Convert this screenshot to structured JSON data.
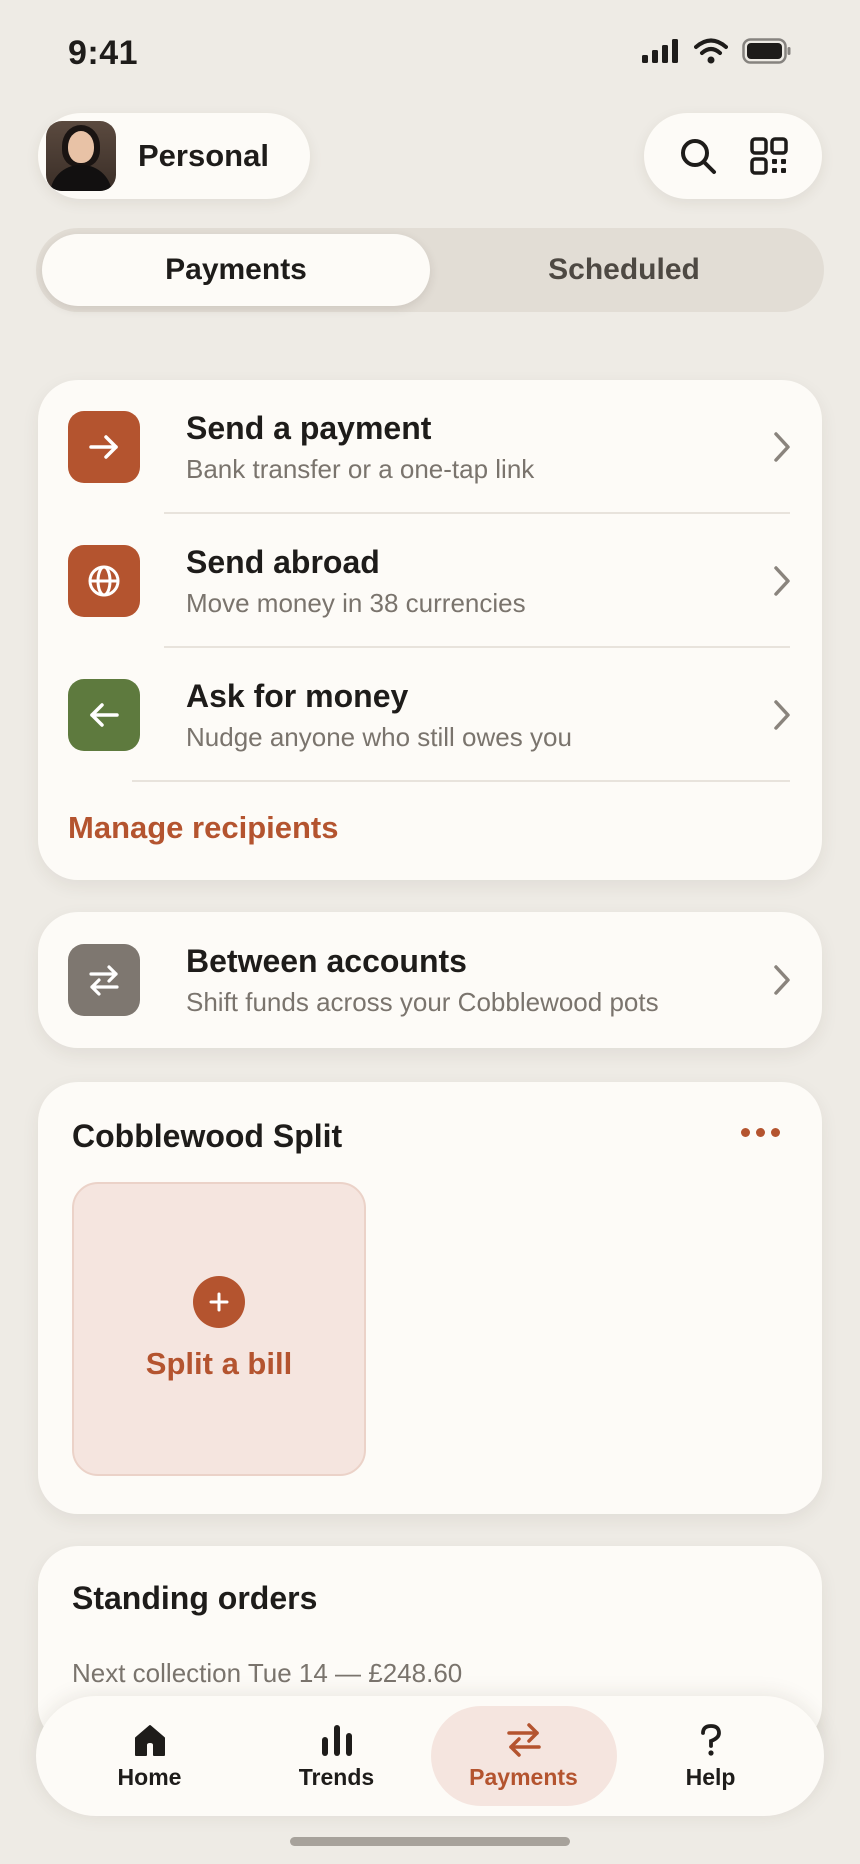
{
  "status_bar": {
    "time": "9:41"
  },
  "header": {
    "account_label": "Personal",
    "actions": [
      {
        "name": "search-icon"
      },
      {
        "name": "qr-code-icon"
      }
    ]
  },
  "segmented": {
    "tabs": [
      "Payments",
      "Scheduled"
    ],
    "active": "Payments"
  },
  "payments_card": {
    "rows": [
      {
        "title": "Send a payment",
        "subtitle": "Bank transfer or a one-tap link",
        "icon": "arrow-right-icon",
        "color": "#B4542F"
      },
      {
        "title": "Send abroad",
        "subtitle": "Move money in 38 currencies",
        "icon": "globe-icon",
        "color": "#B4542F"
      },
      {
        "title": "Ask for money",
        "subtitle": "Nudge anyone who still owes you",
        "icon": "arrow-left-icon",
        "color": "#5E7A3E"
      }
    ],
    "link": "Manage recipients"
  },
  "between_accounts": {
    "title": "Between accounts",
    "subtitle": "Shift funds across your Cobblewood pots",
    "icon": "swap-icon",
    "color": "#7E7770"
  },
  "split": {
    "title": "Cobblewood Split",
    "tile_label": "Split a bill"
  },
  "standing_orders": {
    "title": "Standing orders",
    "subtitle": "Next collection Tue 14 — £248.60"
  },
  "tabbar": {
    "items": [
      {
        "label": "Home",
        "icon": "home-icon"
      },
      {
        "label": "Trends",
        "icon": "bar-chart-icon"
      },
      {
        "label": "Payments",
        "icon": "swap-icon"
      },
      {
        "label": "Help",
        "icon": "question-icon"
      }
    ],
    "active": "Payments"
  },
  "colors": {
    "accent": "#B4542F",
    "green": "#5E7A3E",
    "background": "#EEEBE5",
    "card": "#FDFBF7"
  }
}
